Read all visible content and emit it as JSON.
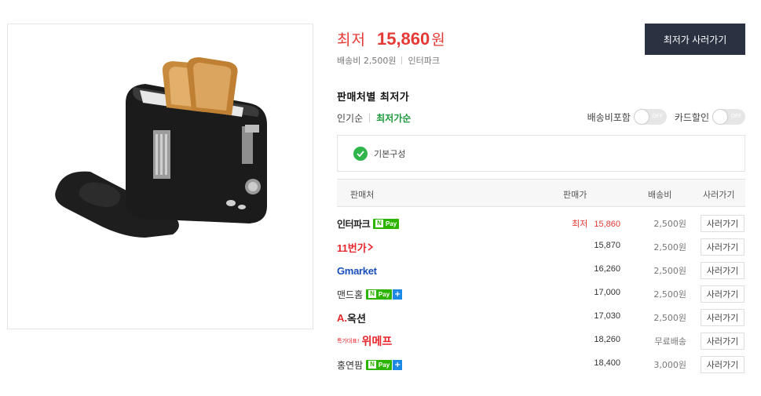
{
  "product": {
    "price_label": "최저",
    "price_value": "15,860",
    "price_unit": "원",
    "shipping": "배송비 2,500원",
    "seller": "인터파크",
    "buy_lowest_label": "최저가 사러가기"
  },
  "section": {
    "title": "판매처별 최저가",
    "sort_popular": "인기순",
    "sort_lowest": "최저가순",
    "toggle_shipping_label": "배송비포함",
    "toggle_card_label": "카드할인",
    "toggle_off_text": "OFF",
    "config_label": "기본구성"
  },
  "table": {
    "headers": {
      "seller": "판매처",
      "price": "판매가",
      "shipping": "배송비",
      "buy": "사러가기"
    },
    "rows": [
      {
        "seller": "인터파크",
        "npay": "Pay",
        "price_tag": "최저",
        "price": "15,860",
        "shipping": "2,500원",
        "buy": "사러가기"
      },
      {
        "seller": "11번가",
        "price": "15,870",
        "shipping": "2,500원",
        "buy": "사러가기"
      },
      {
        "seller": "Gmarket",
        "price": "16,260",
        "shipping": "2,500원",
        "buy": "사러가기"
      },
      {
        "seller": "맨드홈",
        "npay": "Pay",
        "price": "17,000",
        "shipping": "2,500원",
        "buy": "사러가기"
      },
      {
        "seller": "옥션",
        "seller_prefix": "A.",
        "price": "17,030",
        "shipping": "2,500원",
        "buy": "사러가기"
      },
      {
        "seller": "위메프",
        "seller_sub": "특가대표!",
        "price": "18,260",
        "shipping": "무료배송",
        "buy": "사러가기"
      },
      {
        "seller": "홍연팜",
        "npay": "Pay",
        "price": "18,400",
        "shipping": "3,000원",
        "buy": "사러가기"
      }
    ]
  },
  "colors": {
    "accent_red": "#e53935",
    "dark_button": "#2a3242",
    "green_active": "#1a9a3a",
    "npay_green": "#2db400"
  },
  "icons": {
    "check": "check-circle-icon",
    "npay_plus": "plus-icon"
  }
}
